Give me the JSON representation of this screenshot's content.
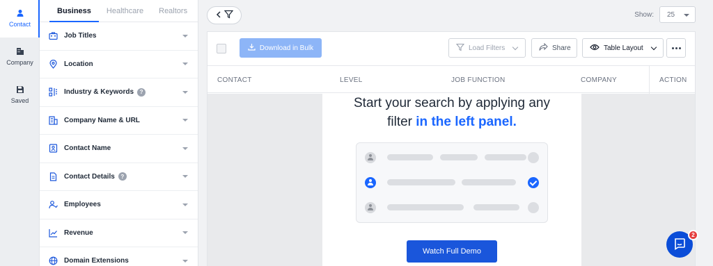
{
  "rail": {
    "items": [
      {
        "label": "Contact",
        "icon": "person-icon",
        "active": true
      },
      {
        "label": "Company",
        "icon": "building-icon",
        "active": false
      },
      {
        "label": "Saved",
        "icon": "save-icon",
        "active": false
      }
    ]
  },
  "panel": {
    "tabs": [
      "Business",
      "Healthcare",
      "Realtors"
    ],
    "active_tab": "Business",
    "filters": [
      {
        "label": "Job Titles",
        "icon": "briefcase-icon",
        "help": false
      },
      {
        "label": "Location",
        "icon": "map-pin-icon",
        "help": false
      },
      {
        "label": "Industry & Keywords",
        "icon": "industry-icon",
        "help": true
      },
      {
        "label": "Company Name & URL",
        "icon": "building-icon",
        "help": false
      },
      {
        "label": "Contact Name",
        "icon": "contact-card-icon",
        "help": false
      },
      {
        "label": "Contact Details",
        "icon": "document-icon",
        "help": true
      },
      {
        "label": "Employees",
        "icon": "employees-icon",
        "help": false
      },
      {
        "label": "Revenue",
        "icon": "chart-up-icon",
        "help": false
      },
      {
        "label": "Domain Extensions",
        "icon": "globe-icon",
        "help": false
      }
    ],
    "help_glyph": "?"
  },
  "topbar": {
    "show_label": "Show:",
    "show_value": "25"
  },
  "toolbar": {
    "download_label": "Download in Bulk",
    "load_filters_label": "Load Filters",
    "share_label": "Share",
    "table_layout_label": "Table Layout"
  },
  "table": {
    "columns": [
      "CONTACT",
      "LEVEL",
      "JOB FUNCTION",
      "COMPANY",
      "ACTION"
    ]
  },
  "empty_state": {
    "line1": "Start your search by applying any",
    "line2_prefix": "filter ",
    "line2_highlight": "in the left panel.",
    "cta_label": "Watch Full Demo"
  },
  "chat": {
    "badge_count": "2"
  },
  "colors": {
    "accent": "#1a66ff",
    "cta": "#1a56db",
    "bulk_button": "#8db5f7",
    "badge": "#e53e3e"
  }
}
